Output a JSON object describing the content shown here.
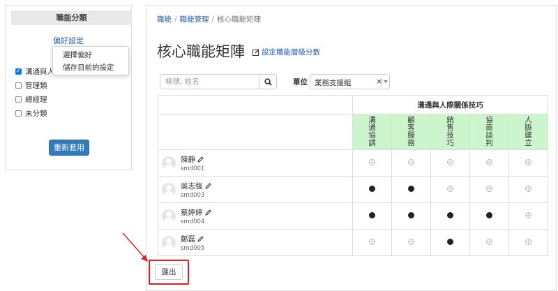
{
  "sidebar": {
    "title": "職能分類",
    "preference_link": "偏好設定",
    "dropdown": [
      "選擇偏好",
      "儲存目前的設定"
    ],
    "filters": [
      {
        "label": "溝通與人際",
        "checked": true
      },
      {
        "label": "管理類",
        "checked": false
      },
      {
        "label": "總經理",
        "checked": false
      },
      {
        "label": "未分類",
        "checked": false
      }
    ],
    "reapply_button": "重新套用"
  },
  "breadcrumb": [
    "職能",
    "職能管理",
    "核心職能矩陣"
  ],
  "page": {
    "title": "核心職能矩陣",
    "level_link": "設定職能層級分數"
  },
  "search": {
    "placeholder": "帳號, 姓名"
  },
  "unit": {
    "label": "單位",
    "value": "業務支援組",
    "clear": "×"
  },
  "table": {
    "group_header": "溝通與人際關係技巧",
    "skills": [
      "溝通協調",
      "顧客服務",
      "銷售技巧",
      "協商談判",
      "人脈建立"
    ],
    "people": [
      {
        "name": "陳靜",
        "id": "smd001",
        "levels": [
          0,
          0,
          0,
          0,
          0
        ]
      },
      {
        "name": "吳志強",
        "id": "smd003",
        "levels": [
          1,
          1,
          0,
          0,
          0
        ]
      },
      {
        "name": "蔡婷婷",
        "id": "smd004",
        "levels": [
          1,
          1,
          1,
          1,
          0
        ]
      },
      {
        "name": "鄭磊",
        "id": "smd005",
        "levels": [
          0,
          0,
          1,
          0,
          0
        ]
      }
    ]
  },
  "export_button": "匯出",
  "colors": {
    "accent": "#337ab7",
    "skill_header_bg": "#cdf5cd",
    "highlight": "#e02020"
  },
  "icons": [
    "search-icon",
    "edit-icon",
    "pencil-icon",
    "avatar-icon",
    "chevron-down-icon"
  ]
}
